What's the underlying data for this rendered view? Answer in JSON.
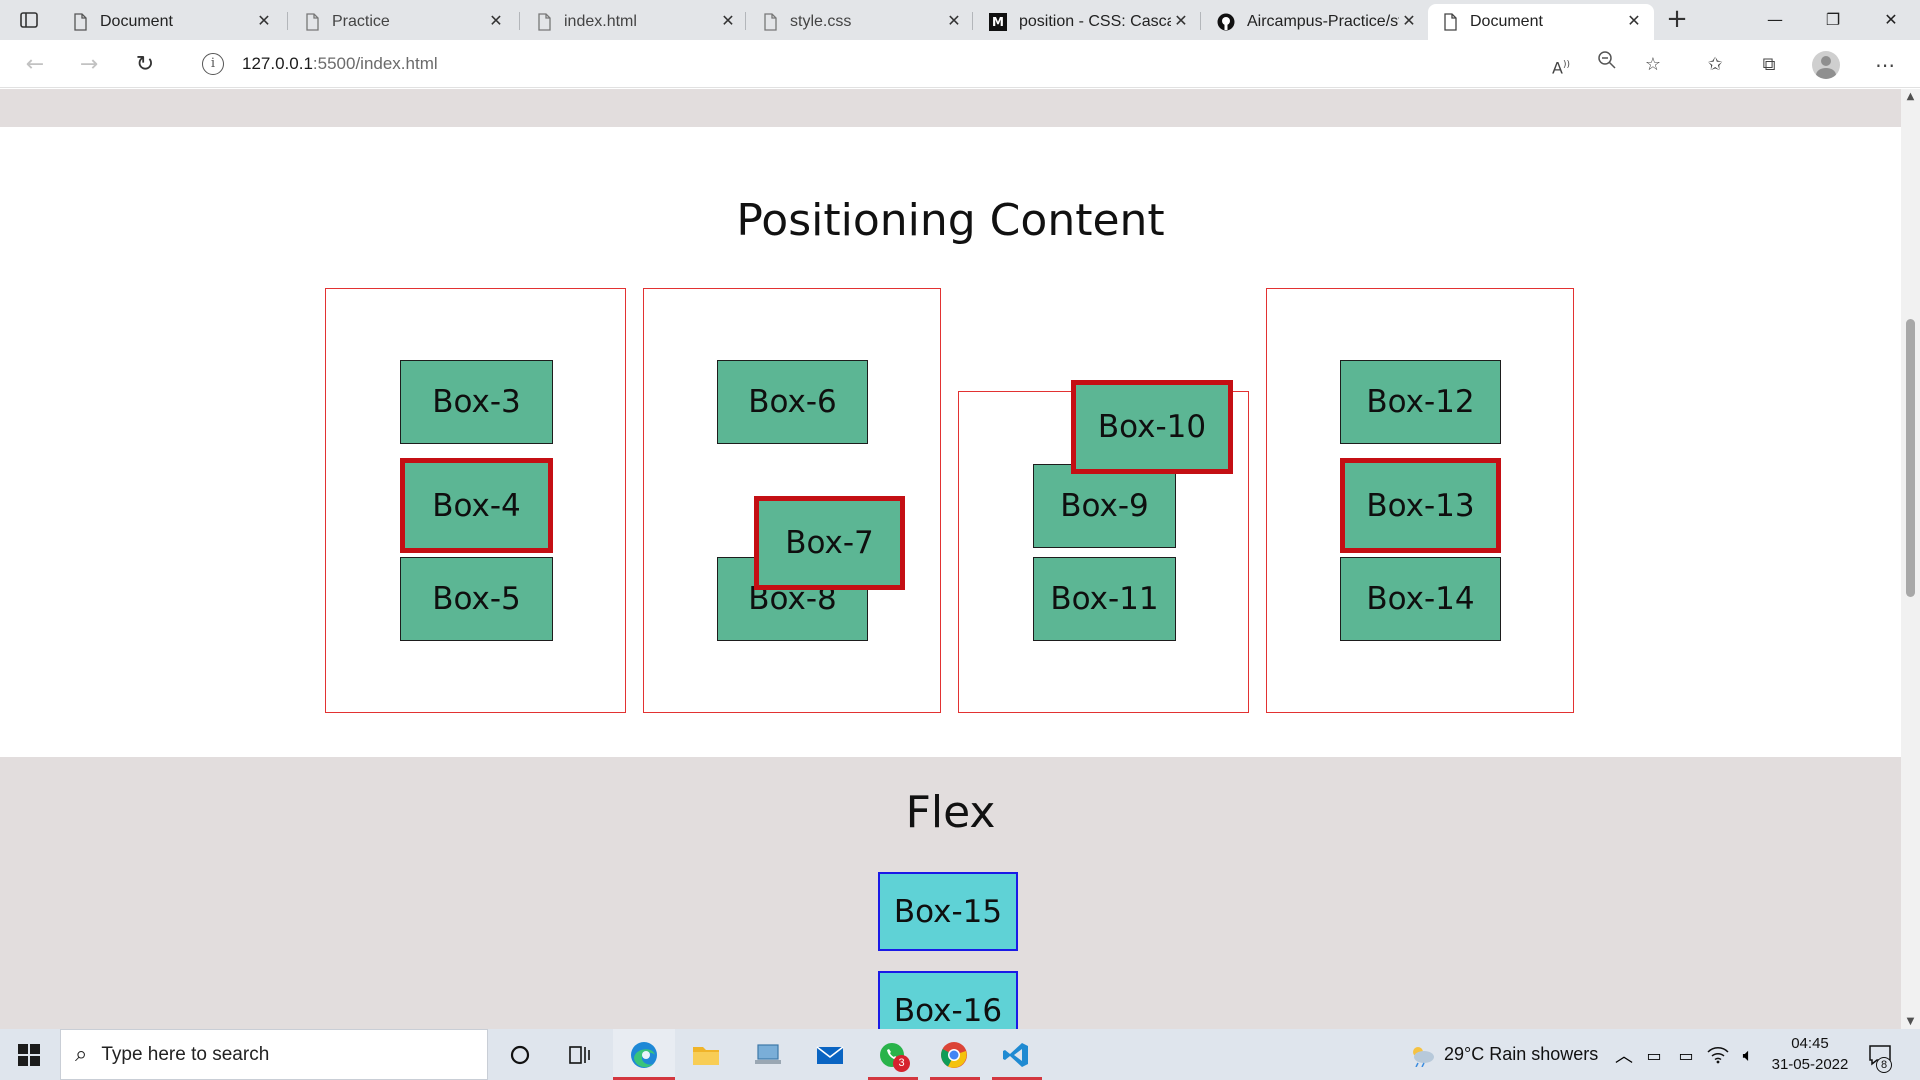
{
  "browser": {
    "tabs": [
      {
        "label": "Document",
        "icon": "page-icon",
        "active": false
      },
      {
        "label": "Practice",
        "icon": "page-icon",
        "active": false
      },
      {
        "label": "index.html",
        "icon": "page-icon",
        "active": false
      },
      {
        "label": "style.css",
        "icon": "page-icon",
        "active": false
      },
      {
        "label": "position - CSS: Cascad",
        "icon": "mdn-icon",
        "active": false
      },
      {
        "label": "Aircampus-Practice/st",
        "icon": "github-icon",
        "active": false
      },
      {
        "label": "Document",
        "icon": "page-icon",
        "active": true
      }
    ],
    "address": {
      "host": "127.0.0.1",
      "rest": ":5500/index.html"
    }
  },
  "page": {
    "positioning_title": "Positioning Content",
    "flex_title": "Flex",
    "containers": [
      {
        "boxes": [
          "Box-3",
          "Box-4",
          "Box-5"
        ]
      },
      {
        "boxes": [
          "Box-6",
          "Box-7",
          "Box-8"
        ]
      },
      {
        "boxes": [
          "Box-9",
          "Box-10",
          "Box-11"
        ]
      },
      {
        "boxes": [
          "Box-12",
          "Box-13",
          "Box-14"
        ]
      }
    ],
    "flex_boxes": [
      "Box-15",
      "Box-16"
    ],
    "colors": {
      "box_green": "#5cb694",
      "box_cyan": "#5fd2d6",
      "container_border": "#e23232",
      "highlight_border": "#c40f14",
      "band_gray": "#e2dddd"
    }
  },
  "taskbar": {
    "search_placeholder": "Type here to search",
    "whatsapp_badge": "3",
    "weather": "29°C  Rain showers",
    "time": "04:45",
    "date": "31-05-2022",
    "notifications": "8"
  }
}
